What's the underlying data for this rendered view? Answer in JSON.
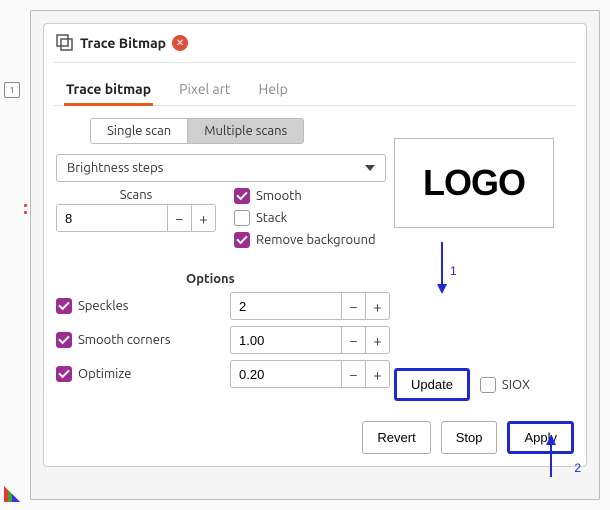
{
  "dialog": {
    "title": "Trace Bitmap",
    "close_icon_label": "✕"
  },
  "page_indicator": "1",
  "tabs": {
    "trace_bitmap": "Trace bitmap",
    "pixel_art": "Pixel art",
    "help": "Help"
  },
  "mode": {
    "single_scan": "Single scan",
    "multiple_scans": "Multiple scans"
  },
  "method": {
    "selected": "Brightness steps"
  },
  "scans": {
    "label": "Scans",
    "value": "8"
  },
  "checks": {
    "smooth": "Smooth",
    "stack": "Stack",
    "remove_bg": "Remove background"
  },
  "options": {
    "header": "Options",
    "speckles": {
      "label": "Speckles",
      "value": "2"
    },
    "smooth_corners": {
      "label": "Smooth corners",
      "value": "1.00"
    },
    "optimize": {
      "label": "Optimize",
      "value": "0.20"
    }
  },
  "preview": {
    "text": "LOGO"
  },
  "buttons": {
    "update": "Update",
    "siox": "SIOX",
    "revert": "Revert",
    "stop": "Stop",
    "apply": "Apply"
  },
  "annotations": {
    "one": "1",
    "two": "2"
  }
}
